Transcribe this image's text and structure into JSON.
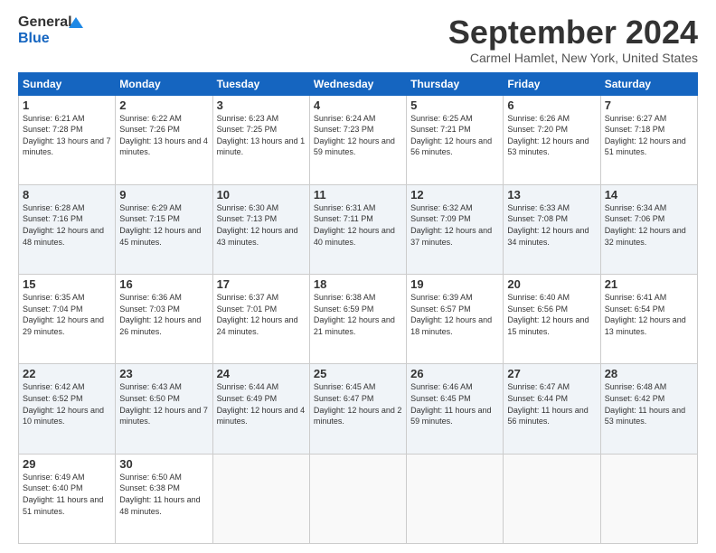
{
  "header": {
    "logo_top": "General",
    "logo_bot": "Blue",
    "month_title": "September 2024",
    "location": "Carmel Hamlet, New York, United States"
  },
  "days_of_week": [
    "Sunday",
    "Monday",
    "Tuesday",
    "Wednesday",
    "Thursday",
    "Friday",
    "Saturday"
  ],
  "weeks": [
    [
      {
        "num": "1",
        "sunrise": "Sunrise: 6:21 AM",
        "sunset": "Sunset: 7:28 PM",
        "daylight": "Daylight: 13 hours and 7 minutes."
      },
      {
        "num": "2",
        "sunrise": "Sunrise: 6:22 AM",
        "sunset": "Sunset: 7:26 PM",
        "daylight": "Daylight: 13 hours and 4 minutes."
      },
      {
        "num": "3",
        "sunrise": "Sunrise: 6:23 AM",
        "sunset": "Sunset: 7:25 PM",
        "daylight": "Daylight: 13 hours and 1 minute."
      },
      {
        "num": "4",
        "sunrise": "Sunrise: 6:24 AM",
        "sunset": "Sunset: 7:23 PM",
        "daylight": "Daylight: 12 hours and 59 minutes."
      },
      {
        "num": "5",
        "sunrise": "Sunrise: 6:25 AM",
        "sunset": "Sunset: 7:21 PM",
        "daylight": "Daylight: 12 hours and 56 minutes."
      },
      {
        "num": "6",
        "sunrise": "Sunrise: 6:26 AM",
        "sunset": "Sunset: 7:20 PM",
        "daylight": "Daylight: 12 hours and 53 minutes."
      },
      {
        "num": "7",
        "sunrise": "Sunrise: 6:27 AM",
        "sunset": "Sunset: 7:18 PM",
        "daylight": "Daylight: 12 hours and 51 minutes."
      }
    ],
    [
      {
        "num": "8",
        "sunrise": "Sunrise: 6:28 AM",
        "sunset": "Sunset: 7:16 PM",
        "daylight": "Daylight: 12 hours and 48 minutes."
      },
      {
        "num": "9",
        "sunrise": "Sunrise: 6:29 AM",
        "sunset": "Sunset: 7:15 PM",
        "daylight": "Daylight: 12 hours and 45 minutes."
      },
      {
        "num": "10",
        "sunrise": "Sunrise: 6:30 AM",
        "sunset": "Sunset: 7:13 PM",
        "daylight": "Daylight: 12 hours and 43 minutes."
      },
      {
        "num": "11",
        "sunrise": "Sunrise: 6:31 AM",
        "sunset": "Sunset: 7:11 PM",
        "daylight": "Daylight: 12 hours and 40 minutes."
      },
      {
        "num": "12",
        "sunrise": "Sunrise: 6:32 AM",
        "sunset": "Sunset: 7:09 PM",
        "daylight": "Daylight: 12 hours and 37 minutes."
      },
      {
        "num": "13",
        "sunrise": "Sunrise: 6:33 AM",
        "sunset": "Sunset: 7:08 PM",
        "daylight": "Daylight: 12 hours and 34 minutes."
      },
      {
        "num": "14",
        "sunrise": "Sunrise: 6:34 AM",
        "sunset": "Sunset: 7:06 PM",
        "daylight": "Daylight: 12 hours and 32 minutes."
      }
    ],
    [
      {
        "num": "15",
        "sunrise": "Sunrise: 6:35 AM",
        "sunset": "Sunset: 7:04 PM",
        "daylight": "Daylight: 12 hours and 29 minutes."
      },
      {
        "num": "16",
        "sunrise": "Sunrise: 6:36 AM",
        "sunset": "Sunset: 7:03 PM",
        "daylight": "Daylight: 12 hours and 26 minutes."
      },
      {
        "num": "17",
        "sunrise": "Sunrise: 6:37 AM",
        "sunset": "Sunset: 7:01 PM",
        "daylight": "Daylight: 12 hours and 24 minutes."
      },
      {
        "num": "18",
        "sunrise": "Sunrise: 6:38 AM",
        "sunset": "Sunset: 6:59 PM",
        "daylight": "Daylight: 12 hours and 21 minutes."
      },
      {
        "num": "19",
        "sunrise": "Sunrise: 6:39 AM",
        "sunset": "Sunset: 6:57 PM",
        "daylight": "Daylight: 12 hours and 18 minutes."
      },
      {
        "num": "20",
        "sunrise": "Sunrise: 6:40 AM",
        "sunset": "Sunset: 6:56 PM",
        "daylight": "Daylight: 12 hours and 15 minutes."
      },
      {
        "num": "21",
        "sunrise": "Sunrise: 6:41 AM",
        "sunset": "Sunset: 6:54 PM",
        "daylight": "Daylight: 12 hours and 13 minutes."
      }
    ],
    [
      {
        "num": "22",
        "sunrise": "Sunrise: 6:42 AM",
        "sunset": "Sunset: 6:52 PM",
        "daylight": "Daylight: 12 hours and 10 minutes."
      },
      {
        "num": "23",
        "sunrise": "Sunrise: 6:43 AM",
        "sunset": "Sunset: 6:50 PM",
        "daylight": "Daylight: 12 hours and 7 minutes."
      },
      {
        "num": "24",
        "sunrise": "Sunrise: 6:44 AM",
        "sunset": "Sunset: 6:49 PM",
        "daylight": "Daylight: 12 hours and 4 minutes."
      },
      {
        "num": "25",
        "sunrise": "Sunrise: 6:45 AM",
        "sunset": "Sunset: 6:47 PM",
        "daylight": "Daylight: 12 hours and 2 minutes."
      },
      {
        "num": "26",
        "sunrise": "Sunrise: 6:46 AM",
        "sunset": "Sunset: 6:45 PM",
        "daylight": "Daylight: 11 hours and 59 minutes."
      },
      {
        "num": "27",
        "sunrise": "Sunrise: 6:47 AM",
        "sunset": "Sunset: 6:44 PM",
        "daylight": "Daylight: 11 hours and 56 minutes."
      },
      {
        "num": "28",
        "sunrise": "Sunrise: 6:48 AM",
        "sunset": "Sunset: 6:42 PM",
        "daylight": "Daylight: 11 hours and 53 minutes."
      }
    ],
    [
      {
        "num": "29",
        "sunrise": "Sunrise: 6:49 AM",
        "sunset": "Sunset: 6:40 PM",
        "daylight": "Daylight: 11 hours and 51 minutes."
      },
      {
        "num": "30",
        "sunrise": "Sunrise: 6:50 AM",
        "sunset": "Sunset: 6:38 PM",
        "daylight": "Daylight: 11 hours and 48 minutes."
      },
      null,
      null,
      null,
      null,
      null
    ]
  ]
}
